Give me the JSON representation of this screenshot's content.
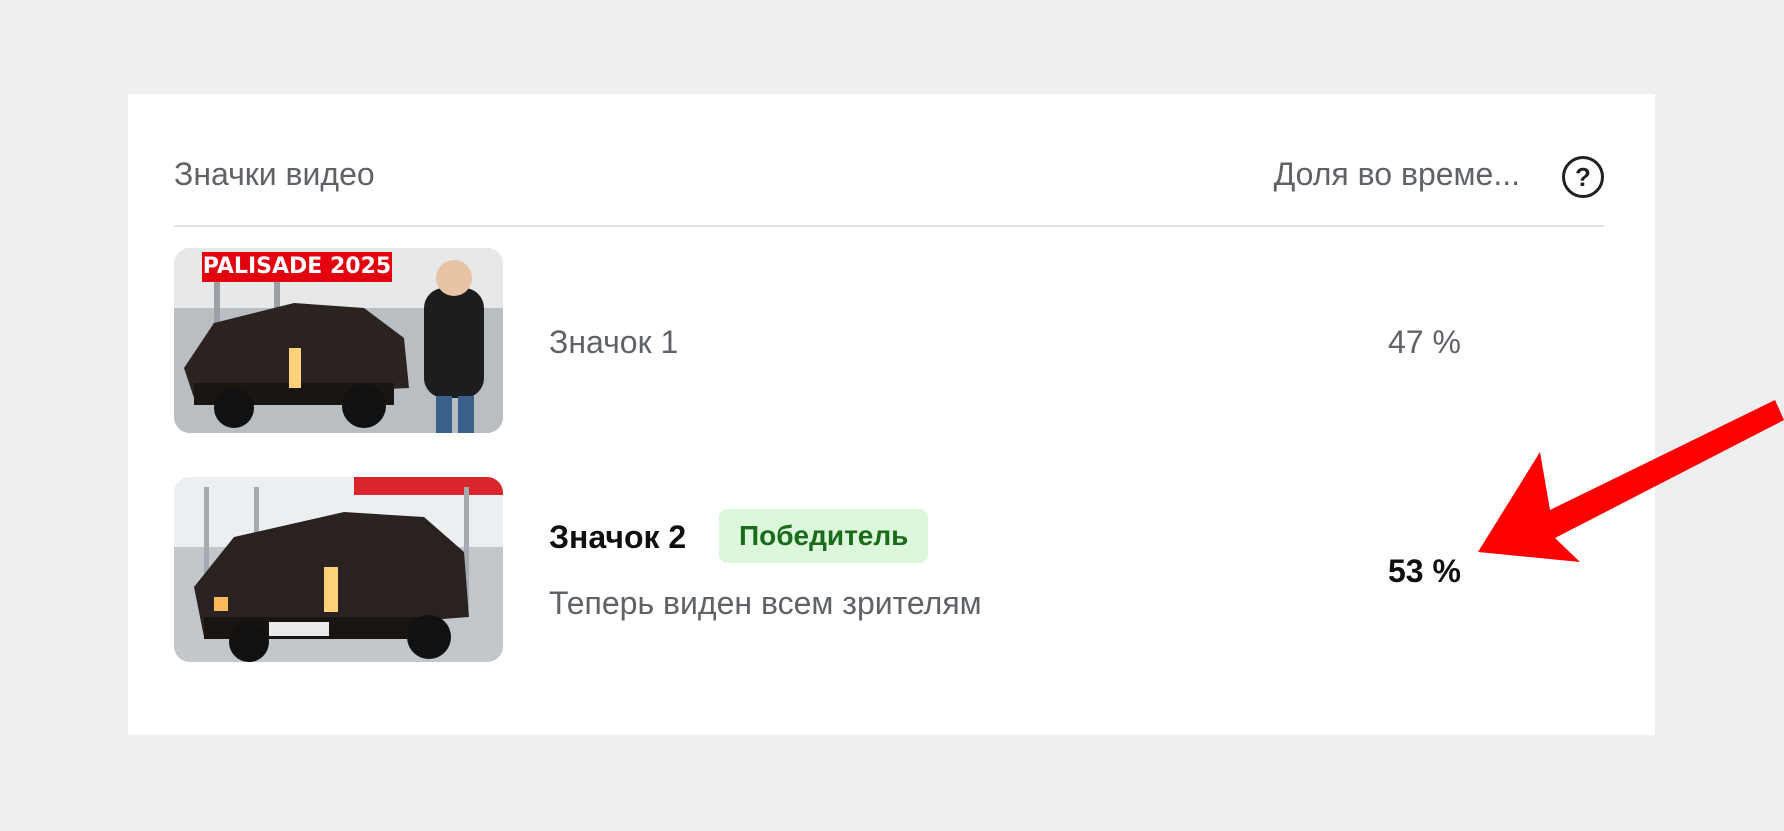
{
  "header": {
    "left_label": "Значки видео",
    "right_label": "Доля во време...",
    "help_glyph": "?"
  },
  "thumbnails": [
    {
      "title": "Значок 1",
      "share": "47 %",
      "thumb_caption": "PALISADE 2025"
    },
    {
      "title": "Значок 2",
      "badge": "Победитель",
      "subtitle": "Теперь виден всем зрителям",
      "share": "53 %"
    }
  ],
  "colors": {
    "badge_bg": "#dcf7dc",
    "badge_text": "#1a6b1a",
    "arrow": "#ff0000",
    "caption_bg": "#e3000f"
  }
}
